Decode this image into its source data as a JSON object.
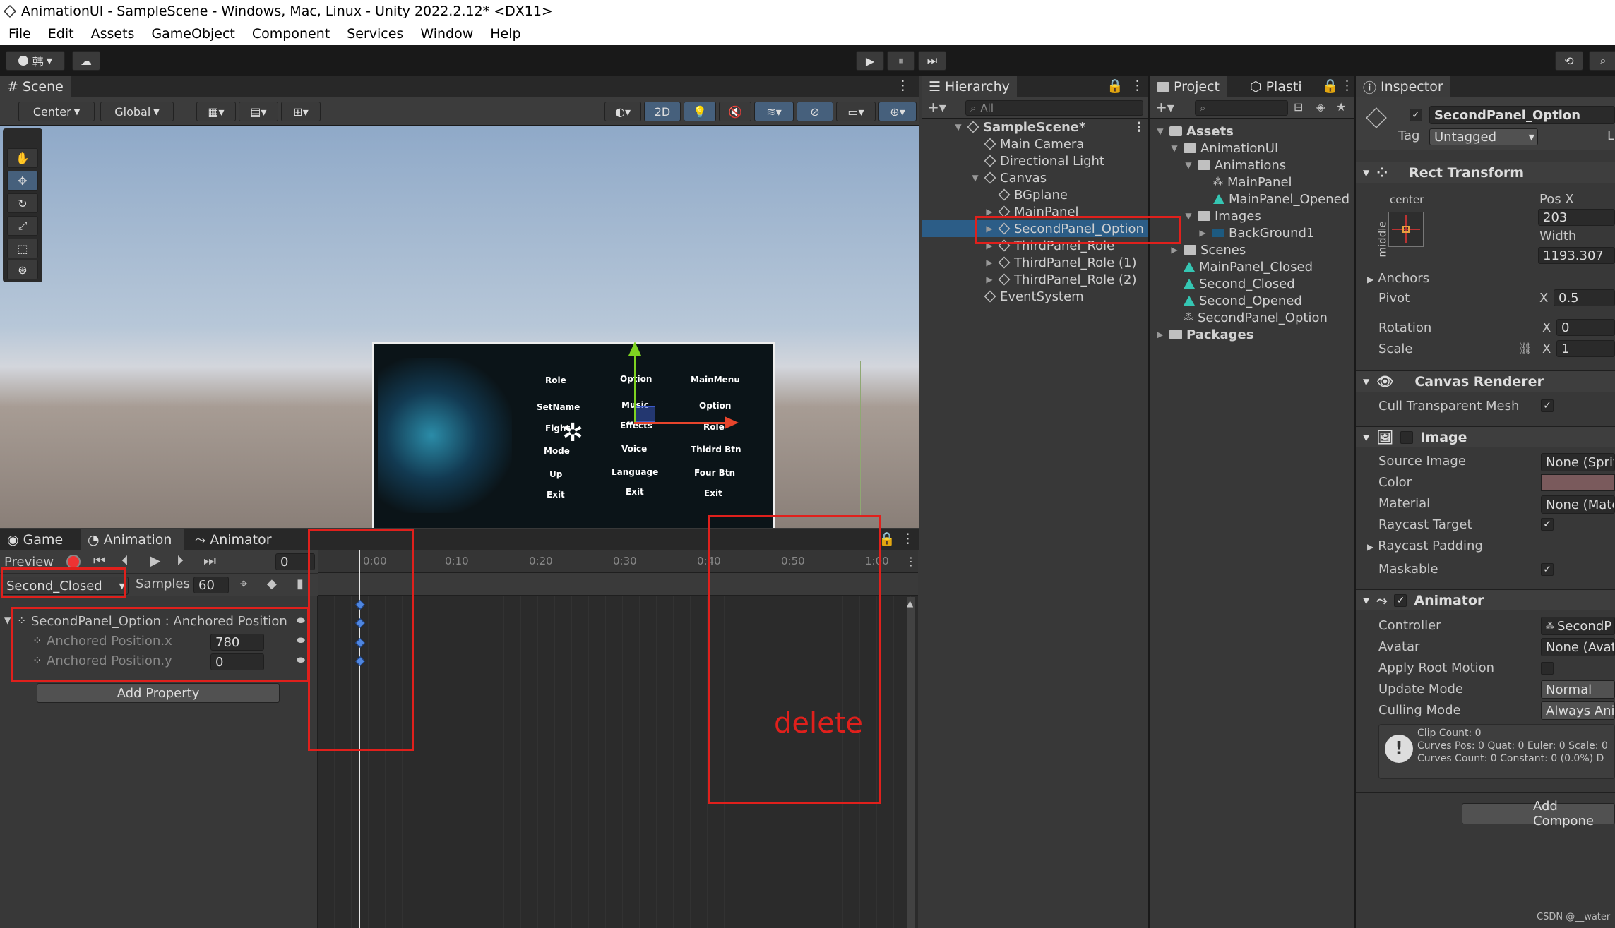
{
  "window_title": "AnimationUI - SampleScene - Windows, Mac, Linux - Unity 2022.2.12* <DX11>",
  "menu": [
    "File",
    "Edit",
    "Assets",
    "GameObject",
    "Component",
    "Services",
    "Window",
    "Help"
  ],
  "toolbar": {
    "account": "韩",
    "play": "▶",
    "pause": "⏸",
    "step": "⏭"
  },
  "scene": {
    "tab": "Scene",
    "pivot": "Center",
    "space": "Global",
    "mode_2d": "2D",
    "canvas_columns": [
      [
        "Role",
        "SetName",
        "Fight",
        "Mode",
        "Up",
        "Exit"
      ],
      [
        "Option",
        "Music",
        "Effects",
        "Voice",
        "Language",
        "Exit"
      ],
      [
        "MainMenu",
        "Option",
        "Role",
        "Thidrd Btn",
        "Four Btn",
        "Exit"
      ]
    ]
  },
  "hierarchy": {
    "tab": "Hierarchy",
    "search_placeholder": "All",
    "items": [
      {
        "label": "SampleScene*",
        "bold": true
      },
      {
        "label": "Main Camera"
      },
      {
        "label": "Directional Light"
      },
      {
        "label": "Canvas"
      },
      {
        "label": "BGplane"
      },
      {
        "label": "MainPanel"
      },
      {
        "label": "SecondPanel_Option"
      },
      {
        "label": "ThirdPanel_Role"
      },
      {
        "label": "ThirdPanel_Role (1)"
      },
      {
        "label": "ThirdPanel_Role (2)"
      },
      {
        "label": "EventSystem"
      }
    ]
  },
  "project": {
    "tabs": [
      "Project",
      "Plasti"
    ],
    "items": [
      {
        "label": "Assets"
      },
      {
        "label": "AnimationUI"
      },
      {
        "label": "Animations"
      },
      {
        "label": "MainPanel"
      },
      {
        "label": "MainPanel_Opened"
      },
      {
        "label": "Images"
      },
      {
        "label": "BackGround1"
      },
      {
        "label": "Scenes"
      },
      {
        "label": "MainPanel_Closed"
      },
      {
        "label": "Second_Closed"
      },
      {
        "label": "Second_Opened"
      },
      {
        "label": "SecondPanel_Option"
      },
      {
        "label": "Packages"
      }
    ]
  },
  "inspector": {
    "tab": "Inspector",
    "object_name": "SecondPanel_Option",
    "tag_label": "Tag",
    "tag_value": "Untagged",
    "layer_abbrev": "L",
    "rect_transform": {
      "title": "Rect Transform",
      "anchor_h": "center",
      "anchor_v": "middle",
      "posx_label": "Pos X",
      "posx": "203",
      "width_label": "Width",
      "width": "1193.307",
      "anchors": "Anchors",
      "pivot_label": "Pivot",
      "pivot_x_label": "X",
      "pivot_x": "0.5",
      "rotation_label": "Rotation",
      "rotation_x_label": "X",
      "rotation_x": "0",
      "scale_label": "Scale",
      "scale_x_label": "X",
      "scale_x": "1"
    },
    "canvas_renderer": {
      "title": "Canvas Renderer",
      "cull": "Cull Transparent Mesh"
    },
    "image": {
      "title": "Image",
      "source_label": "Source Image",
      "source": "None (Sprit",
      "color_label": "Color",
      "color_swatch": "#7a5a5c",
      "material_label": "Material",
      "material": "None (Mate",
      "raycast_target": "Raycast Target",
      "raycast_padding": "Raycast Padding",
      "maskable": "Maskable"
    },
    "animator": {
      "title": "Animator",
      "controller_label": "Controller",
      "controller": "SecondP",
      "avatar_label": "Avatar",
      "avatar": "None (Avat",
      "root_motion": "Apply Root Motion",
      "update_label": "Update Mode",
      "update": "Normal",
      "culling_label": "Culling Mode",
      "culling": "Always Ani",
      "info": [
        "Clip Count: 0",
        "Curves Pos: 0 Quat: 0 Euler: 0 Scale: 0",
        "Curves Count: 0 Constant: 0 (0.0%) D"
      ]
    },
    "add_component": "Add Compone"
  },
  "animation": {
    "tabs": [
      "Game",
      "Animation",
      "Animator"
    ],
    "preview": "Preview",
    "frame": "0",
    "clip": "Second_Closed",
    "samples_label": "Samples",
    "samples": "60",
    "property_group": "SecondPanel_Option : Anchored Position",
    "props": [
      {
        "label": "Anchored Position.x",
        "value": "780"
      },
      {
        "label": "Anchored Position.y",
        "value": "0"
      }
    ],
    "add_property": "Add Property",
    "ruler": [
      "0:00",
      "0:10",
      "0:20",
      "0:30",
      "0:40",
      "0:50",
      "1:00"
    ]
  },
  "annotation": {
    "text": "delete",
    "color": "#e0201c"
  },
  "watermark": "CSDN @__water"
}
